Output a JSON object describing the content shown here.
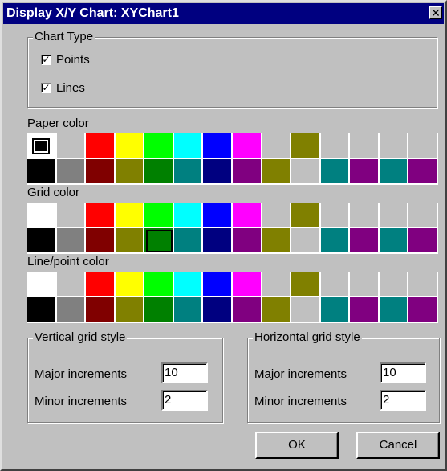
{
  "window": {
    "title": "Display X/Y Chart: XYChart1",
    "close_glyph": "✕"
  },
  "chart_type": {
    "legend": "Chart Type",
    "points": {
      "label": "Points",
      "checked": true
    },
    "lines": {
      "label": "Lines",
      "checked": true
    }
  },
  "palette": {
    "row1": [
      "#ffffff",
      "#c0c0c0",
      "#ff0000",
      "#ffff00",
      "#00ff00",
      "#00ffff",
      "#0000ff",
      "#ff00ff",
      "#c0c0c0",
      "#808000",
      "#c0c0c0",
      "#c0c0c0",
      "#c0c0c0",
      "#c0c0c0"
    ],
    "row2": [
      "#000000",
      "#808080",
      "#800000",
      "#808000",
      "#008000",
      "#008080",
      "#000080",
      "#800080",
      "#808000",
      "#c0c0c0",
      "#008080",
      "#800080",
      "#008080",
      "#800080"
    ]
  },
  "paper_color": {
    "label": "Paper color",
    "selected": "#ffffff"
  },
  "grid_color": {
    "label": "Grid color",
    "selected": "#008000"
  },
  "line_point_color": {
    "label": "Line/point color"
  },
  "vertical_grid": {
    "legend": "Vertical grid style",
    "major_label": "Major increments",
    "major_value": "10",
    "minor_label": "Minor increments",
    "minor_value": "2"
  },
  "horizontal_grid": {
    "legend": "Horizontal grid style",
    "major_label": "Major increments",
    "major_value": "10",
    "minor_label": "Minor increments",
    "minor_value": "2"
  },
  "buttons": {
    "ok": "OK",
    "cancel": "Cancel"
  }
}
